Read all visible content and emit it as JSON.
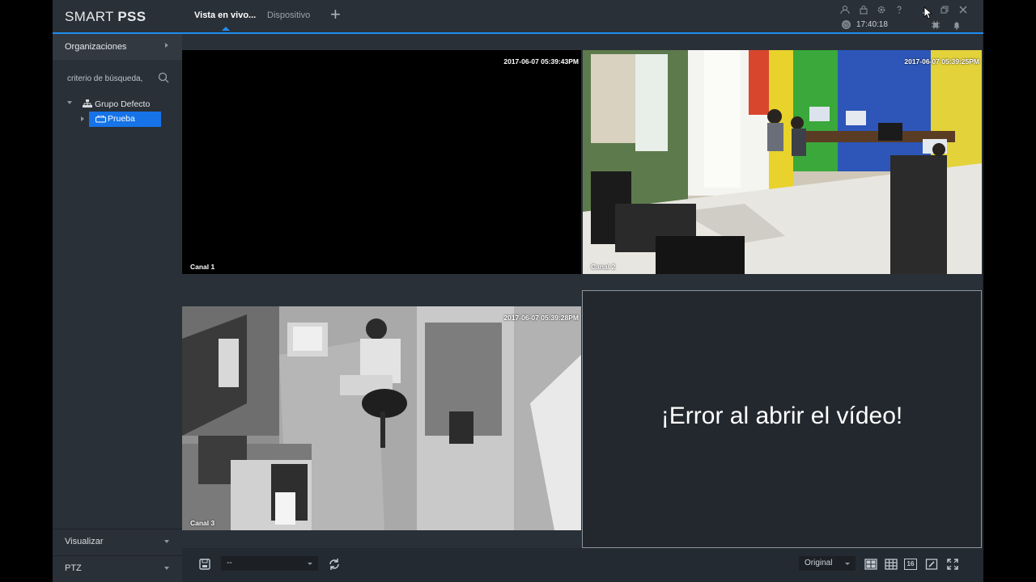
{
  "app": {
    "logo_light": "SMART ",
    "logo_bold": "PSS",
    "tabs": [
      {
        "label": "Vista en vivo...",
        "active": true
      },
      {
        "label": "Dispositivo",
        "active": false
      }
    ],
    "time": "17:40:18",
    "accent_color": "#1f8ef1"
  },
  "titlebar_icons": [
    "user-icon",
    "lock-icon",
    "gear-icon",
    "help-icon",
    "minimize-icon",
    "restore-icon",
    "close-icon",
    "cpu-icon",
    "bell-icon"
  ],
  "sidebar": {
    "header": "Organizaciones",
    "search_placeholder": "criterio de búsqueda,",
    "tree": {
      "group": "Grupo Defecto",
      "device": "Prueba"
    },
    "sections": [
      "Visualizar",
      "PTZ"
    ]
  },
  "channels": [
    {
      "label": "Canal 1",
      "timestamp": "2017-06-07 05:39:43PM",
      "state": "black"
    },
    {
      "label": "Canal 2",
      "timestamp": "2017-06-07 05:39:25PM",
      "state": "video"
    },
    {
      "label": "Canal 3",
      "timestamp": "2017-06-07 05:39:28PM",
      "state": "video"
    },
    {
      "label": "",
      "timestamp": "",
      "state": "error",
      "message": "¡Error al abrir el vídeo!"
    }
  ],
  "bottombar": {
    "preset_value": "--",
    "aspect_value": "Original",
    "layout_16": "16"
  }
}
